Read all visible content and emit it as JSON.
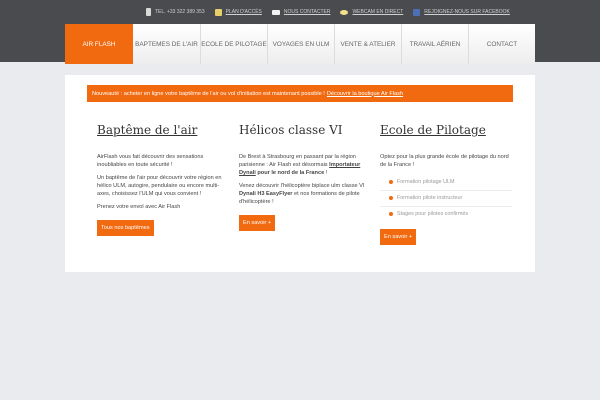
{
  "topbar": {
    "phone": "TEL. +33 322 389 353",
    "map": "PLAN D'ACCÈS",
    "contact": "NOUS CONTACTER",
    "webcam": "WEBCAM EN DIRECT",
    "facebook": "REJOIGNEZ-NOUS SUR FACEBOOK"
  },
  "nav": {
    "items": [
      "Air Flash",
      "Baptemes de l'air",
      "Ecole de pilotage",
      "Voyages en ULM",
      "Vente & atelier",
      "Travail aérien",
      "Contact"
    ]
  },
  "notice": {
    "text": "Nouveauté : acheter en ligne votre baptême de l'air ou vol d'initiation est maintenant possible !",
    "link": "Découvrir la boutique Air Flash"
  },
  "col1": {
    "title": "Baptême de l'air",
    "p1": "AirFlash vous fait découvrir des sensations inoubliables en toute sécurité !",
    "p2": "Un baptême de l'air pour découvrir votre région en hélico ULM, autogire, pendulaire ou encore multi-axes, choisissez l'ULM qui vous convient !",
    "p3": "Prenez votre envol avec Air Flash",
    "button": "Tous nos baptêmes"
  },
  "col2": {
    "title": "Hélicos classe VI",
    "p1a": "De Brest à Strasbourg en passant par la région parisienne : Air Flash est désormais",
    "p1b": "Importateur Dynali",
    "p1c": "pour le nord de la France",
    "p1d": "!",
    "p2a": "Venez découvrir l'hélicoptère biplace ulm classe VI",
    "p2b": "Dynali H3 EasyFlyer",
    "p2c": "et nos formations de pilote d'hélicoptère !",
    "button": "En savoir +"
  },
  "col3": {
    "title": "Ecole de Pilotage",
    "p1": "Optez pour la plus grande école de pilotage du nord de la France !",
    "bullets": [
      "Formation pilotage ULM",
      "Formation pilote instructeur",
      "Stages pour pilotes confirmés"
    ],
    "button": "En savoir +"
  },
  "colors": {
    "accent": "#f26a10",
    "topbar": "#4a4b4e",
    "background": "#e9ebef"
  }
}
